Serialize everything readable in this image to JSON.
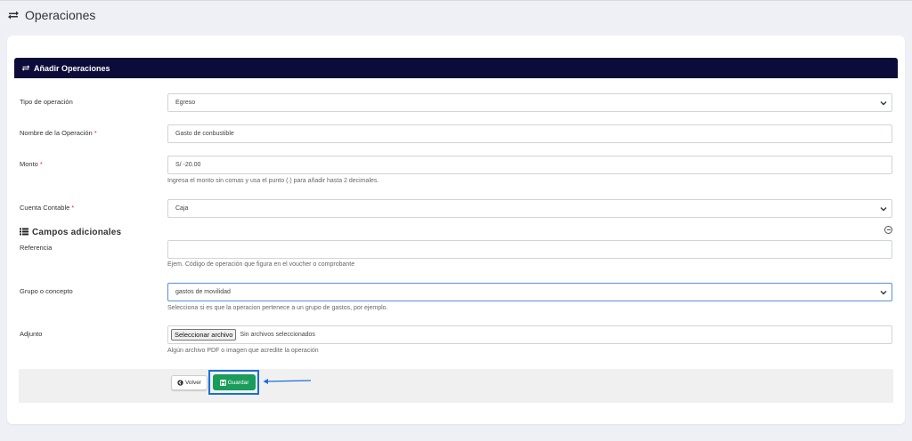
{
  "page": {
    "title": "Operaciones",
    "title_icon": "repeat-icon"
  },
  "card": {
    "title": "Añadir Operaciones",
    "title_icon": "repeat-icon",
    "header_color": "#0d0b3a"
  },
  "form": {
    "tipo": {
      "label": "Tipo de operación",
      "value": "Egreso"
    },
    "nombre": {
      "label": "Nombre de la Operación",
      "required": "*",
      "value": "Gasto de conbustible"
    },
    "monto": {
      "label": "Monto",
      "required": "*",
      "value": "S/ -20.00",
      "help": "Ingresa el monto sin comas y usa el punto (.) para añadir hasta 2 decimales."
    },
    "cuenta": {
      "label": "Cuenta Contable",
      "required": "*",
      "value": "Caja"
    }
  },
  "extra": {
    "title": "Campos adicionales",
    "title_icon": "list-icon",
    "referencia": {
      "label": "Referencia",
      "value": "",
      "help": "Ejem. Código de operación que figura en el voucher o comprobante"
    },
    "grupo": {
      "label": "Grupo o concepto",
      "value": "gastos de movilidad",
      "help": "Selecciona si es que la operacion pertenece a un grupo de gastos, por ejemplo."
    },
    "adjunto": {
      "label": "Adjunto",
      "button": "Seleccionar archivo",
      "status": "Sin archivos seleccionados",
      "help": "Algún archivo PDF o imagen que acredite la operación"
    }
  },
  "actions": {
    "back": {
      "label": "Volver",
      "icon": "arrow-left-circle-icon"
    },
    "save": {
      "label": "Guardar",
      "icon": "floppy-disk-icon",
      "color": "#1a9c5b"
    },
    "highlight_color": "#1a6fd6"
  }
}
